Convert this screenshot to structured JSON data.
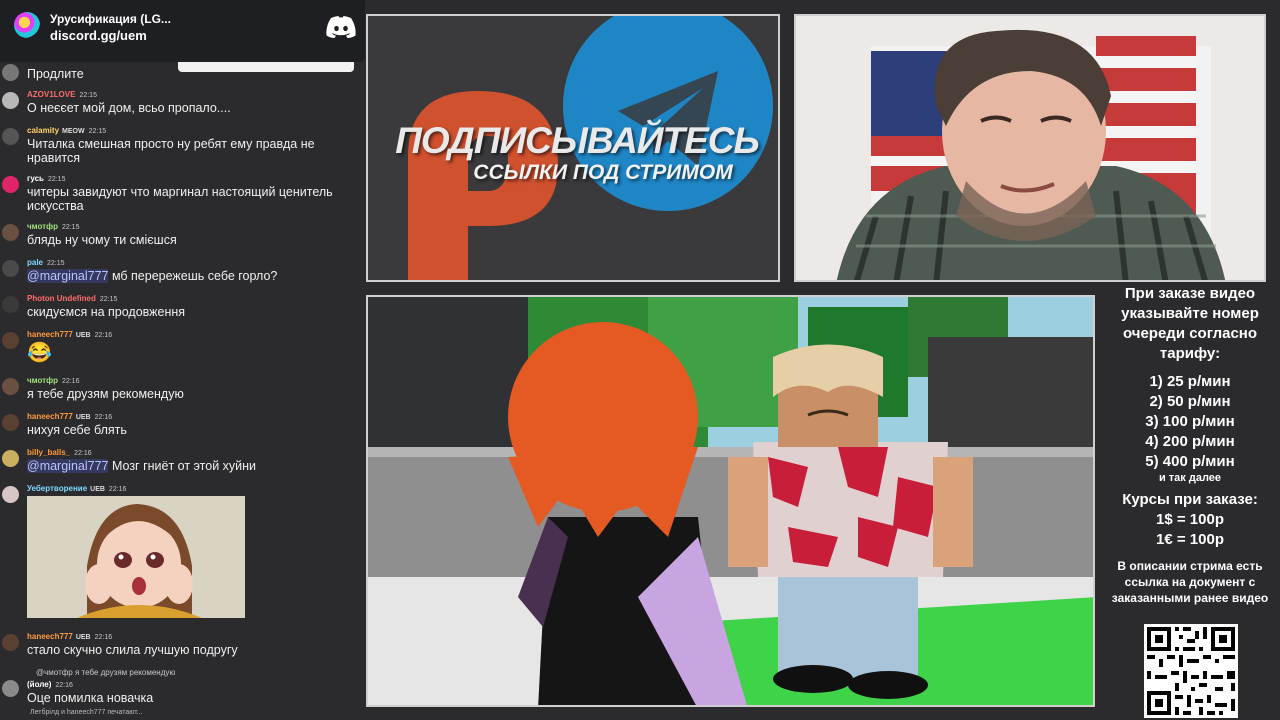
{
  "discord": {
    "server_name": "Урусификация (LG...",
    "invite": "discord.gg/uem",
    "logo_icon": "discord-logo-icon"
  },
  "chat": {
    "messages": [
      {
        "user": "",
        "time": "",
        "text": "Продлите",
        "color": "#ffffff"
      },
      {
        "user": "AZOV1LOVE",
        "time": "22:15",
        "text": "О неєєет мой дом, всьо пропало....",
        "color": "#ff6b6b"
      },
      {
        "user": "calamity",
        "badges": "MEOW",
        "time": "22:15",
        "text": "Читалка смешная просто ну ребят ему правда не нравится",
        "color": "#ffd166"
      },
      {
        "user": "гусь",
        "time": "22:15",
        "text": "читеры завидуют что маргинал настоящий ценитель искусства",
        "color": "#ffffff"
      },
      {
        "user": "чмотфр",
        "time": "22:15",
        "text": "блядь ну чому ти смієшся",
        "color": "#a0e07a"
      },
      {
        "user": "pale",
        "time": "22:15",
        "mention": "@marginal777",
        "text": " мб перережешь себе горло?",
        "color": "#7fd7ff"
      },
      {
        "user": "Photon Undefined",
        "time": "22:15",
        "text": "скидуємся на продовження",
        "color": "#ff6b6b"
      },
      {
        "user": "haneech777",
        "badges": "UEB",
        "time": "22:16",
        "text": "😂",
        "color": "#ff9a3c"
      },
      {
        "user": "чмотфр",
        "time": "22:16",
        "text": "я тебе друзям рекомендую",
        "color": "#a0e07a"
      },
      {
        "user": "haneech777",
        "badges": "UEB",
        "time": "22:16",
        "text": "нихуя себе блять",
        "color": "#ff9a3c"
      },
      {
        "user": "billy_balls_",
        "time": "22:16",
        "mention": "@marginal777",
        "text": " Мозг гниёт от этой хуйни",
        "color": "#ff9a3c"
      },
      {
        "user": "Уебертворение",
        "badges": "UEB",
        "time": "22:16",
        "text": "",
        "color": "#7fd7ff"
      },
      {
        "user": "haneech777",
        "badges": "UEB",
        "time": "22:16",
        "text": "стало скучно слила лучшую подругу",
        "color": "#ff9a3c"
      },
      {
        "user": "(йоле)",
        "time": "22:16",
        "reply": "@чмотфр я тебе друзям рекомендую",
        "text": "Оце помилка новачка",
        "color": "#ffffff"
      }
    ],
    "typing": "Летбрілд и haneech777 печатают..."
  },
  "promo": {
    "title": "ПОДПИСЫВАЙТЕСЬ",
    "subtitle": "ССЫЛКИ ПОД СТРИМОМ"
  },
  "info": {
    "heading": "При заказе видео указывайте номер очереди согласно тарифу:",
    "tariffs": [
      "1) 25 р/мин",
      "2) 50 р/мин",
      "3) 100 р/мин",
      "4) 200 р/мин",
      "5) 400 р/мин"
    ],
    "tariff_note": "и так далее",
    "rates_heading": "Курсы при заказе:",
    "rates": [
      "1$ = 100р",
      "1€ = 100р"
    ],
    "description": "В описании стрима есть ссылка на документ с заказанными ранее видео"
  },
  "colors": {
    "bg": "#2b2b2e",
    "panel_border": "#cfcfcf",
    "telegram": "#1f86c6",
    "patreon": "#d0512e"
  }
}
